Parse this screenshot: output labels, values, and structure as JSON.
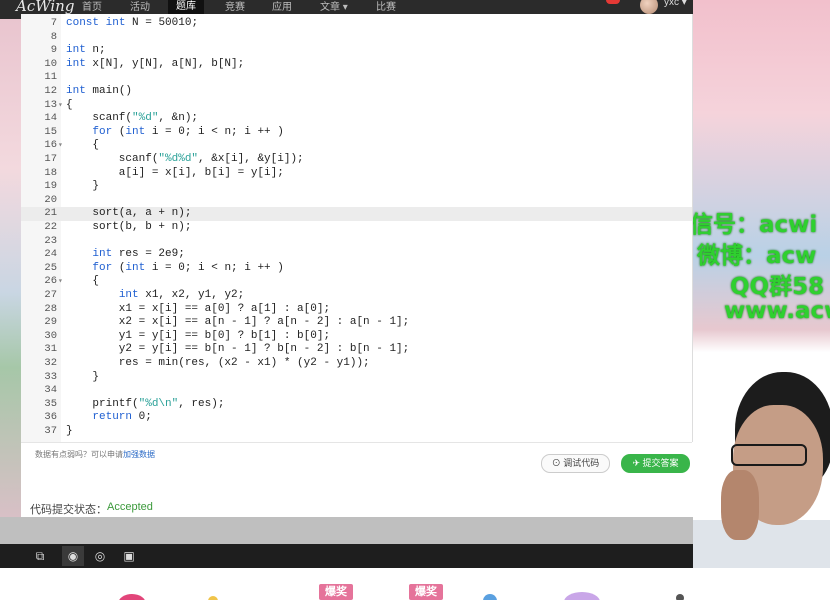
{
  "nav": {
    "logo": "AcWing",
    "items": [
      "首页",
      "活动",
      "题库",
      "竞赛",
      "应用",
      "文章 ▾",
      "比赛"
    ],
    "active_index": 2,
    "username": "yxc ▾"
  },
  "editor": {
    "lines": [
      {
        "n": "7",
        "fold": "",
        "code": "const int N = 50010;"
      },
      {
        "n": "8",
        "fold": "",
        "code": ""
      },
      {
        "n": "9",
        "fold": "",
        "code": "int n;"
      },
      {
        "n": "10",
        "fold": "",
        "code": "int x[N], y[N], a[N], b[N];"
      },
      {
        "n": "11",
        "fold": "",
        "code": ""
      },
      {
        "n": "12",
        "fold": "",
        "code": "int main()"
      },
      {
        "n": "13",
        "fold": "▾",
        "code": "{"
      },
      {
        "n": "14",
        "fold": "",
        "code": "    scanf(\"%d\", &n);"
      },
      {
        "n": "15",
        "fold": "",
        "code": "    for (int i = 0; i < n; i ++ )"
      },
      {
        "n": "16",
        "fold": "▾",
        "code": "    {"
      },
      {
        "n": "17",
        "fold": "",
        "code": "        scanf(\"%d%d\", &x[i], &y[i]);"
      },
      {
        "n": "18",
        "fold": "",
        "code": "        a[i] = x[i], b[i] = y[i];"
      },
      {
        "n": "19",
        "fold": "",
        "code": "    }"
      },
      {
        "n": "20",
        "fold": "",
        "code": ""
      },
      {
        "n": "21",
        "fold": "",
        "code": "    sort(a, a + n);"
      },
      {
        "n": "22",
        "fold": "",
        "code": "    sort(b, b + n);"
      },
      {
        "n": "23",
        "fold": "",
        "code": ""
      },
      {
        "n": "24",
        "fold": "",
        "code": "    int res = 2e9;"
      },
      {
        "n": "25",
        "fold": "",
        "code": "    for (int i = 0; i < n; i ++ )"
      },
      {
        "n": "26",
        "fold": "▾",
        "code": "    {"
      },
      {
        "n": "27",
        "fold": "",
        "code": "        int x1, x2, y1, y2;"
      },
      {
        "n": "28",
        "fold": "",
        "code": "        x1 = x[i] == a[0] ? a[1] : a[0];"
      },
      {
        "n": "29",
        "fold": "",
        "code": "        x2 = x[i] == a[n - 1] ? a[n - 2] : a[n - 1];"
      },
      {
        "n": "30",
        "fold": "",
        "code": "        y1 = y[i] == b[0] ? b[1] : b[0];"
      },
      {
        "n": "31",
        "fold": "",
        "code": "        y2 = y[i] == b[n - 1] ? b[n - 2] : b[n - 1];"
      },
      {
        "n": "32",
        "fold": "",
        "code": "        res = min(res, (x2 - x1) * (y2 - y1));"
      },
      {
        "n": "33",
        "fold": "",
        "code": "    }"
      },
      {
        "n": "34",
        "fold": "",
        "code": ""
      },
      {
        "n": "35",
        "fold": "",
        "code": "    printf(\"%d\\n\", res);"
      },
      {
        "n": "36",
        "fold": "",
        "code": "    return 0;"
      },
      {
        "n": "37",
        "fold": "",
        "code": "}"
      }
    ],
    "highlight_line": "21"
  },
  "footer": {
    "hint": "数据有点弱吗？可以申请",
    "hint_link": "加强数据",
    "debug_label": "调试代码",
    "submit_label": "提交答案"
  },
  "status": {
    "label": "代码提交状态：",
    "value": "Accepted"
  },
  "watermark": {
    "line1": "微信号：acwi",
    "line2": "微博：acw",
    "line3": "QQ群58",
    "line4": "www.acw"
  },
  "bottom": {
    "bomb1": "爆奖",
    "bomb2": "爆奖"
  },
  "colors": {
    "accent_green": "#39b54a",
    "accepted": "#3c9a3c",
    "watermark": "#2fd02f"
  }
}
